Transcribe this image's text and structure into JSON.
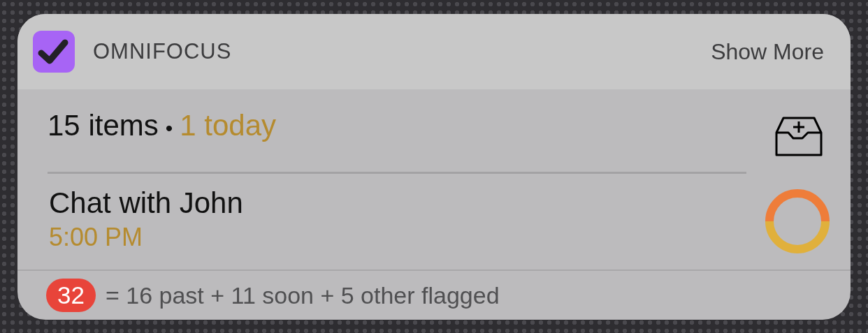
{
  "widget": {
    "app_name": "OMNIFOCUS",
    "action": "Show More"
  },
  "summary": {
    "count": "15 items",
    "separator": "•",
    "today": "1 today"
  },
  "task": {
    "title": "Chat with John",
    "time": "5:00 PM"
  },
  "footer": {
    "badge": "32",
    "breakdown": "= 16 past + 11 soon + 5 other flagged"
  }
}
